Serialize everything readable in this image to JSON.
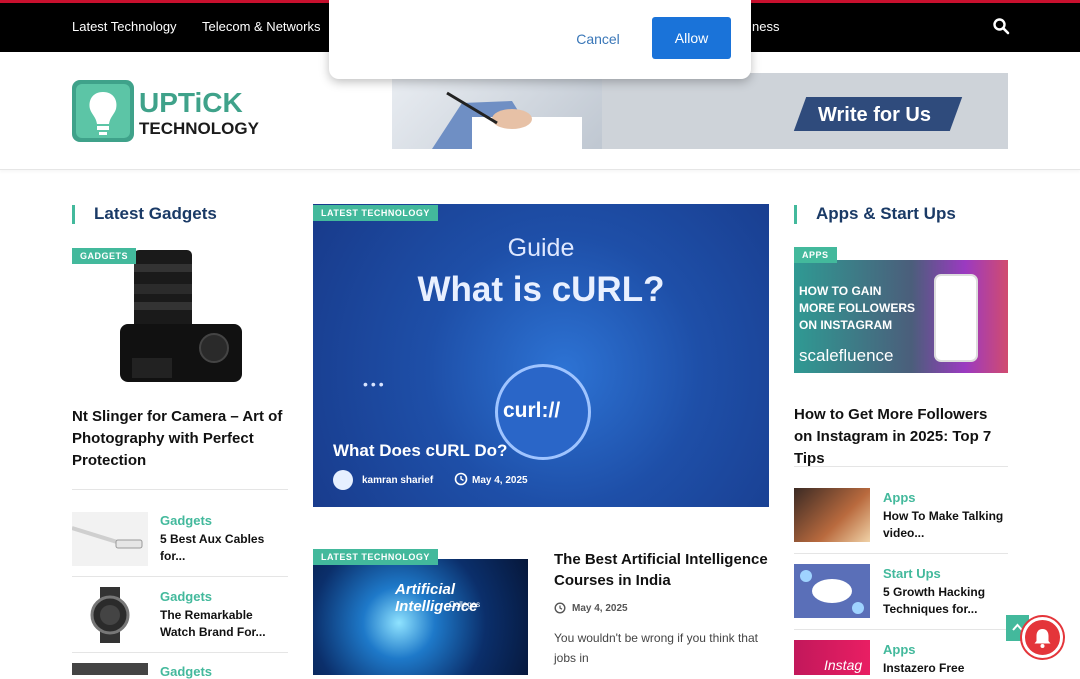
{
  "nav": {
    "items": [
      "Latest Technology",
      "Telecom & Networks",
      "ness"
    ]
  },
  "logo": {
    "line1": "UPTICK",
    "line2": "TECHNOLOGY"
  },
  "banner": {
    "cta": "Write for Us"
  },
  "left": {
    "section_title": "Latest Gadgets",
    "tag": "GADGETS",
    "featured_title": "Nt Slinger for Camera – Art of Photography with Perfect Protection",
    "list": [
      {
        "category": "Gadgets",
        "title": "5 Best Aux Cables for..."
      },
      {
        "category": "Gadgets",
        "title": "The Remarkable Watch Brand For..."
      },
      {
        "category": "Gadgets",
        "title": ""
      }
    ]
  },
  "center": {
    "hero": {
      "tag": "LATEST TECHNOLOGY",
      "image_heading_small": "Guide",
      "image_heading_big": "What is cURL?",
      "image_logo": "curl://",
      "image_dots": "•••",
      "title": "What Does cURL Do?",
      "author": "kamran sharief",
      "date": "May 4, 2025"
    },
    "second": {
      "tag": "LATEST TECHNOLOGY",
      "thumb_text": "Artificial Intelligence",
      "thumb_sub": "Colleges",
      "title": "The Best Artificial Intelligence Courses in India",
      "date": "May 4, 2025",
      "excerpt": "You wouldn't be wrong if you think that jobs in"
    }
  },
  "right": {
    "section_title": "Apps & Start Ups",
    "tag": "APPS",
    "insta_line1": "HOW TO GAIN",
    "insta_line2": "MORE FOLLOWERS",
    "insta_line3": "ON INSTAGRAM",
    "insta_brand": "scalefluence",
    "featured_title": "How to Get More Followers on Instagram in 2025: Top 7 Tips",
    "list": [
      {
        "category": "Apps",
        "title": "How To Make Talking video..."
      },
      {
        "category": "Start Ups",
        "title": "5 Growth Hacking Techniques for..."
      },
      {
        "category": "Apps",
        "title": "Instazero Free"
      }
    ],
    "insta_thumb_text": "Instag"
  },
  "dialog": {
    "cancel": "Cancel",
    "allow": "Allow"
  },
  "colors": {
    "accent": "#43b99c",
    "nav_bg": "#000000",
    "allow_btn": "#1a73d9",
    "heading": "#1a3a66"
  }
}
